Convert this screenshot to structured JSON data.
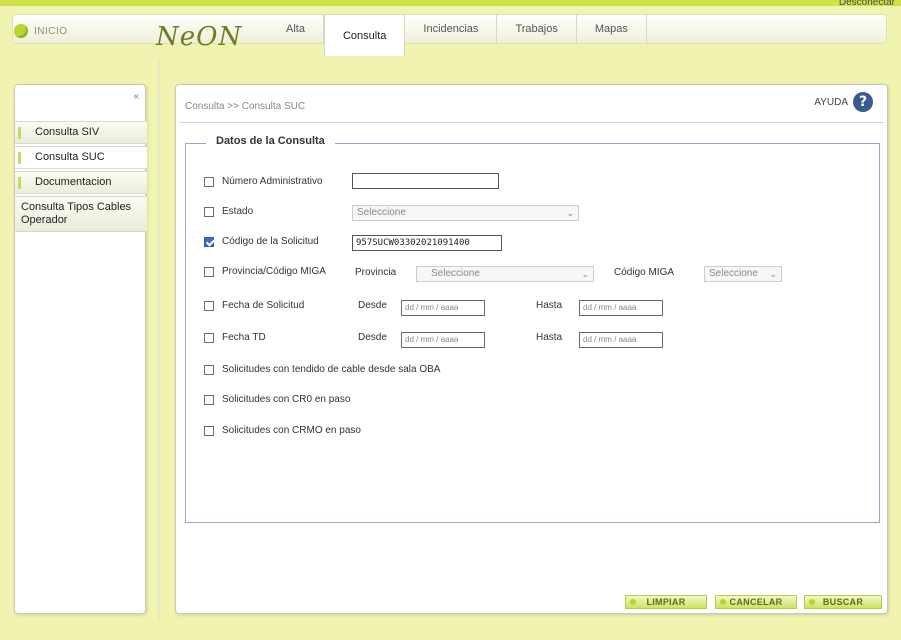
{
  "header": {
    "disconnect_label": "Desconectar",
    "inicio_label": "INICIO",
    "logo_text": "NeON",
    "tabs": [
      {
        "label": "Alta"
      },
      {
        "label": "Consulta"
      },
      {
        "label": "Incidencias"
      },
      {
        "label": "Trabajos"
      },
      {
        "label": "Mapas"
      }
    ]
  },
  "sidebar": {
    "collapse_label": "«",
    "items": [
      {
        "label": "Consulta SIV"
      },
      {
        "label": "Consulta SUC"
      },
      {
        "label": "Documentacion"
      },
      {
        "label": "Consulta Tipos Cables Operador"
      }
    ]
  },
  "main": {
    "breadcrumb": "Consulta >> Consulta SUC",
    "help_label": "AYUDA",
    "help_icon_glyph": "?",
    "fieldset_legend": "Datos de la Consulta",
    "fields": {
      "numero_administrativo": {
        "label": "Número Administrativo",
        "value": "",
        "checked": false
      },
      "estado": {
        "label": "Estado",
        "select_value": "Seleccione",
        "checked": false
      },
      "codigo_solicitud": {
        "label": "Código de la Solicitud",
        "value": "957SUCW03302021091400",
        "checked": true
      },
      "provincia_miga": {
        "label": "Provincia/Código MIGA",
        "provincia_label": "Provincia",
        "provincia_select": "Seleccione",
        "miga_label": "Código MIGA",
        "miga_select": "Seleccione",
        "checked": false
      },
      "fecha_solicitud": {
        "label": "Fecha de Solicitud",
        "desde_label": "Desde",
        "desde_placeholder": "dd / mm / aaaa",
        "hasta_label": "Hasta",
        "hasta_placeholder": "dd / mm / aaaa",
        "checked": false
      },
      "fecha_td": {
        "label": "Fecha TD",
        "desde_label": "Desde",
        "desde_placeholder": "dd / mm / aaaa",
        "hasta_label": "Hasta",
        "hasta_placeholder": "dd / mm / aaaa",
        "checked": false
      },
      "tendido_oba": {
        "label": "Solicitudes con tendido de cable desde sala OBA",
        "checked": false
      },
      "cr0": {
        "label": "Solicitudes con CR0 en paso",
        "checked": false
      },
      "crmo": {
        "label": "Solicitudes con CRMO en paso",
        "checked": false
      }
    },
    "buttons": {
      "limpiar": "LIMPIAR",
      "cancelar": "CANCELAR",
      "buscar": "BUSCAR"
    }
  },
  "colors": {
    "accent_green": "#b7d632",
    "page_background": "#f1f3b0",
    "help_icon": "#3a5b91",
    "checkbox_checked": "#3a6cc8"
  }
}
